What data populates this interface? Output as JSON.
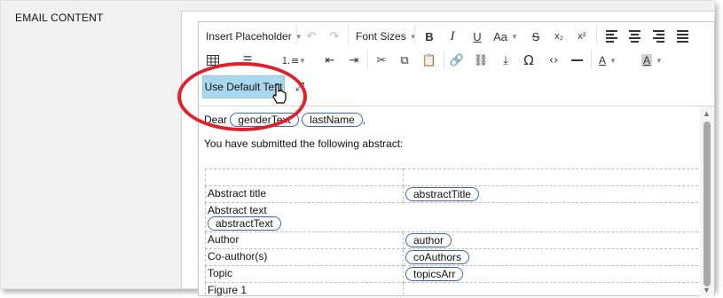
{
  "section": {
    "label": "EMAIL CONTENT"
  },
  "toolbar": {
    "insert_placeholder": "Insert Placeholder",
    "font_sizes": "Font Sizes",
    "bold": "B",
    "italic": "I",
    "underline": "U",
    "case": "Aa",
    "strike": "S",
    "subscript": "x₂",
    "superscript": "x²",
    "use_default_text": "Use Default Text"
  },
  "body": {
    "greeting": "Dear",
    "placeholders": {
      "gender": "genderText",
      "lastname": "lastName"
    },
    "comma": ",",
    "intro": "You have submitted the following abstract:"
  },
  "table": {
    "rows": [
      {
        "label": "",
        "value": ""
      },
      {
        "label": "Abstract title",
        "value": "abstractTitle"
      },
      {
        "label": "Abstract text",
        "value": "abstractText"
      },
      {
        "label": "Author",
        "value": "author"
      },
      {
        "label": "Co-author(s)",
        "value": "coAuthors"
      },
      {
        "label": "Topic",
        "value": "topicsArr"
      },
      {
        "label": "Figure 1",
        "value": ""
      }
    ]
  },
  "colors": {
    "accent_button": "#a9d8ee",
    "placeholder_border": "#3b66b5",
    "annotation": "#e0202a"
  }
}
